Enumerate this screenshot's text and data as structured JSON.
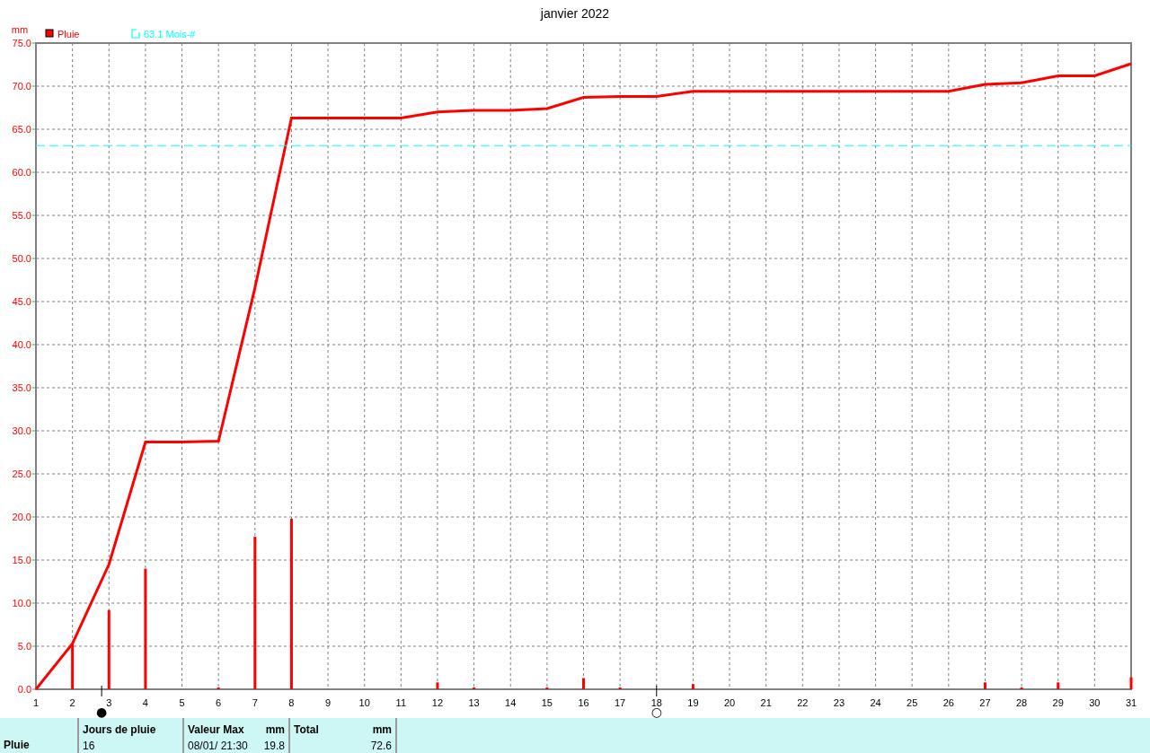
{
  "chart": {
    "chart_data": {
      "type": "line",
      "title": "janvier 2022",
      "ylabel": "mm",
      "x": [
        1,
        2,
        3,
        4,
        5,
        6,
        7,
        8,
        9,
        10,
        11,
        12,
        13,
        14,
        15,
        16,
        17,
        18,
        19,
        20,
        21,
        22,
        23,
        24,
        25,
        26,
        27,
        28,
        29,
        30,
        31
      ],
      "series": [
        {
          "name": "Pluie",
          "type": "line",
          "color": "#ff0000",
          "values": [
            0,
            5.3,
            14.5,
            28.7,
            28.7,
            28.8,
            46.6,
            66.3,
            66.3,
            66.3,
            66.3,
            67.0,
            67.2,
            67.2,
            67.4,
            68.7,
            68.8,
            68.8,
            69.4,
            69.4,
            69.4,
            69.4,
            69.4,
            69.4,
            69.4,
            69.4,
            70.2,
            70.4,
            71.2,
            71.2,
            72.6
          ]
        },
        {
          "name": "63.1 Mois-#",
          "type": "line",
          "line_style": "dashed",
          "color": "#00ffff",
          "values": [
            63.1,
            63.1,
            63.1,
            63.1,
            63.1,
            63.1,
            63.1,
            63.1,
            63.1,
            63.1,
            63.1,
            63.1,
            63.1,
            63.1,
            63.1,
            63.1,
            63.1,
            63.1,
            63.1,
            63.1,
            63.1,
            63.1,
            63.1,
            63.1,
            63.1,
            63.1,
            63.1,
            63.1,
            63.1,
            63.1,
            63.1
          ]
        },
        {
          "type": "bar",
          "color": "#ff0000",
          "values": [
            0,
            5.3,
            9.2,
            14.0,
            0,
            0.1,
            17.7,
            19.8,
            0,
            0,
            0,
            0.8,
            0.2,
            0,
            0.2,
            1.3,
            0.1,
            0,
            0.6,
            0,
            0,
            0,
            0,
            0,
            0,
            0,
            0.8,
            0.2,
            0.8,
            0,
            1.4
          ]
        }
      ],
      "grid": true,
      "legend": "upper left",
      "annotations": [
        "●",
        "○"
      ],
      "xlim": [
        1,
        31
      ],
      "ylim": [
        0,
        75
      ],
      "xticks": [
        1,
        2,
        3,
        4,
        5,
        6,
        7,
        8,
        9,
        10,
        11,
        12,
        13,
        14,
        15,
        16,
        17,
        18,
        19,
        20,
        21,
        22,
        23,
        24,
        25,
        26,
        27,
        28,
        29,
        30,
        31
      ],
      "yticks": [
        {
          "value": 0,
          "label": "0.0"
        },
        {
          "value": 5,
          "label": "5.0"
        },
        {
          "value": 10,
          "label": "10.0"
        },
        {
          "value": 15,
          "label": "15.0"
        },
        {
          "value": 20,
          "label": "20.0"
        },
        {
          "value": 25,
          "label": "25.0"
        },
        {
          "value": 30,
          "label": "30.0"
        },
        {
          "value": 35,
          "label": "35.0"
        },
        {
          "value": 40,
          "label": "40.0"
        },
        {
          "value": 45,
          "label": "45.0"
        },
        {
          "value": 50,
          "label": "50.0"
        },
        {
          "value": 55,
          "label": "55.0"
        },
        {
          "value": 60,
          "label": "60.0"
        },
        {
          "value": 65,
          "label": "65.0"
        },
        {
          "value": 70,
          "label": "70.0"
        },
        {
          "value": 75,
          "label": "75.0"
        }
      ]
    }
  },
  "summary": {
    "row_label": "Pluie",
    "columns": [
      {
        "header": "Jours de pluie",
        "value": "16"
      },
      {
        "header": "Valeur Max",
        "unit": "mm",
        "value": "08/01/  21:30",
        "value_2": "19.8"
      },
      {
        "header": "Total",
        "unit": "mm",
        "value_2": "72.6"
      }
    ]
  }
}
